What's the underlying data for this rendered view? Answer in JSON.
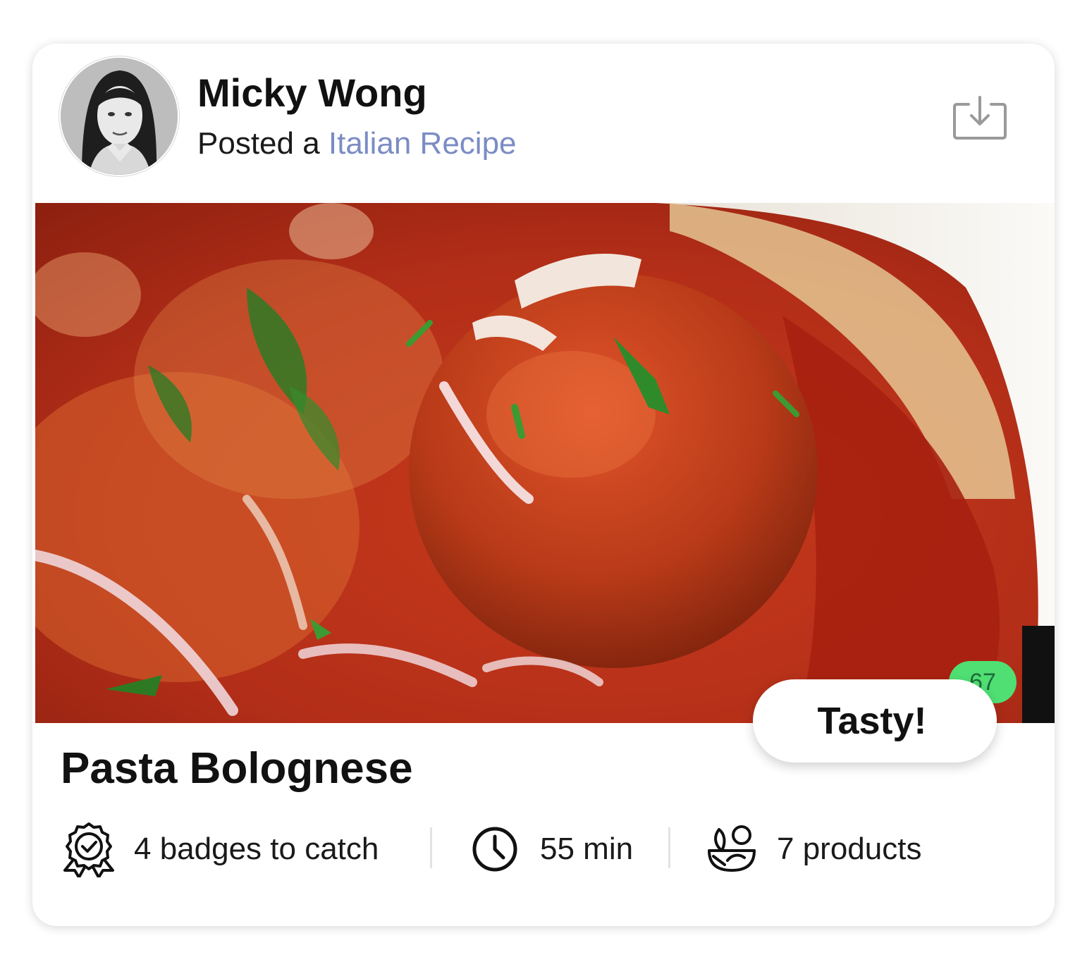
{
  "post": {
    "author_name": "Micky Wong",
    "posted_prefix": "Posted a ",
    "category_link": "Italian Recipe",
    "download_icon": "download-icon"
  },
  "recipe": {
    "title": "Pasta Bolognese",
    "reaction_label": "Tasty!",
    "reaction_count": "67"
  },
  "meta": {
    "badges": {
      "icon": "badge-icon",
      "text": "4 badges to catch"
    },
    "time": {
      "icon": "clock-icon",
      "text": "55 min"
    },
    "products": {
      "icon": "ingredients-icon",
      "text": "7 products"
    }
  },
  "colors": {
    "link": "#7b8cc4",
    "badge_green": "#4fdf73",
    "text_dark": "#111111"
  }
}
